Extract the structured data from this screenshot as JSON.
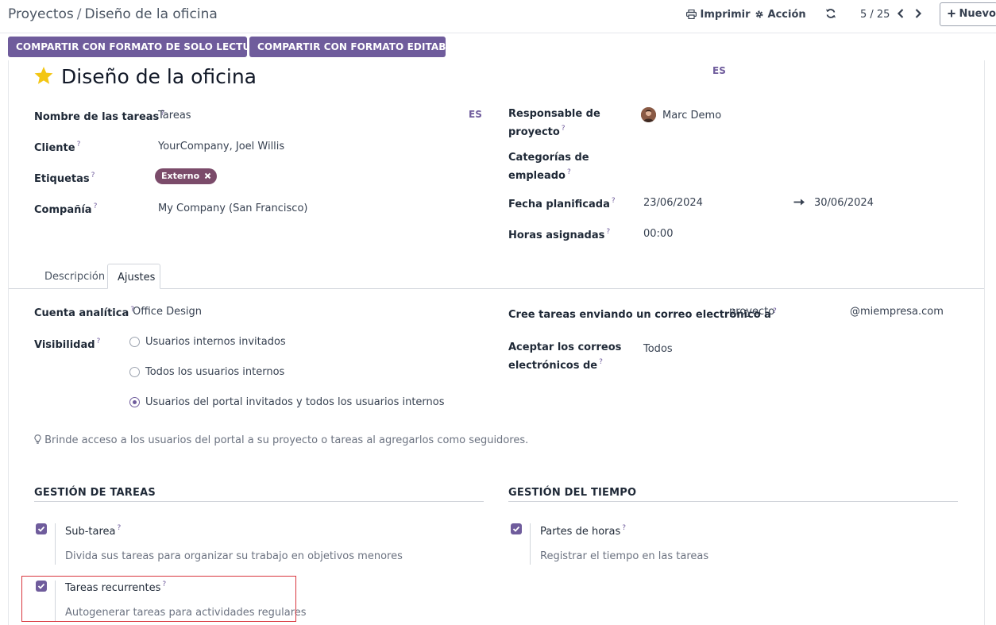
{
  "breadcrumb": {
    "parent": "Proyectos",
    "separator": "/",
    "current": "Diseño de la oficina"
  },
  "toolbar": {
    "print_label": "Imprimir",
    "action_label": "Acción",
    "pager": "5 / 25",
    "new_label": "Nuevo"
  },
  "share": {
    "readonly_label": "COMPARTIR CON FORMATO DE SOLO LECTURA",
    "editable_label": "COMPARTIR CON FORMATO EDITABLE"
  },
  "record": {
    "title": "Diseño de la oficina",
    "title_lang": "ES",
    "left_fields": {
      "tasks_name": {
        "label": "Nombre de las tareas",
        "value": "Tareas",
        "lang": "ES"
      },
      "customer": {
        "label": "Cliente",
        "value": "YourCompany, Joel Willis"
      },
      "tags": {
        "label": "Etiquetas",
        "tag": "Externo"
      },
      "company": {
        "label": "Compañía",
        "value": "My Company (San Francisco)"
      }
    },
    "right_fields": {
      "manager": {
        "label_line1": "Responsable de",
        "label_line2": "proyecto",
        "value": "Marc Demo"
      },
      "employee_categories": {
        "label_line1": "Categorías de",
        "label_line2": "empleado"
      },
      "planned_date": {
        "label": "Fecha planificada",
        "start": "23/06/2024",
        "end": "30/06/2024"
      },
      "allocated_hours": {
        "label": "Horas asignadas",
        "value": "00:00"
      }
    }
  },
  "tabs": [
    {
      "label": "Descripción"
    },
    {
      "label": "Ajustes"
    }
  ],
  "settings": {
    "analytic_account": {
      "label": "Cuenta analítica",
      "value": "Office Design"
    },
    "visibility": {
      "label": "Visibilidad",
      "options": [
        "Usuarios internos invitados",
        "Todos los usuarios internos",
        "Usuarios del portal invitados y todos los usuarios internos"
      ],
      "selected": 2
    },
    "email_alias": {
      "label": "Cree tareas enviando un correo electrónico a",
      "value": "proyecto",
      "domain": "@miempresa.com"
    },
    "accept_emails": {
      "label_line1": "Aceptar los correos",
      "label_line2": "electrónicos de",
      "value": "Todos"
    },
    "hint": "Brinde acceso a los usuarios del portal a su proyecto o tareas al agregarlos como seguidores.",
    "task_management": {
      "title": "GESTIÓN DE TAREAS",
      "items": [
        {
          "name": "Sub-tarea",
          "desc": "Divida sus tareas para organizar su trabajo en objetivos menores",
          "checked": true
        },
        {
          "name": "Tareas recurrentes",
          "desc": "Autogenerar tareas para actividades regulares",
          "checked": true
        }
      ]
    },
    "time_management": {
      "title": "GESTIÓN DEL TIEMPO",
      "items": [
        {
          "name": "Partes de horas",
          "desc": "Registrar el tiempo en las tareas",
          "checked": true
        }
      ]
    }
  },
  "colors": {
    "primary": "#6f5c9c",
    "tag": "#7b4b6a",
    "highlight": "#d9363e",
    "star": "#f3c614"
  },
  "icons": {
    "print": "printer-icon",
    "action": "gear-icon",
    "refresh": "refresh-icon",
    "prev": "chevron-left-icon",
    "next": "chevron-right-icon",
    "new": "plus-icon",
    "favorite": "star-icon",
    "arrow": "arrow-right-icon",
    "hint": "lightbulb-icon",
    "tag_remove": "close-icon"
  }
}
